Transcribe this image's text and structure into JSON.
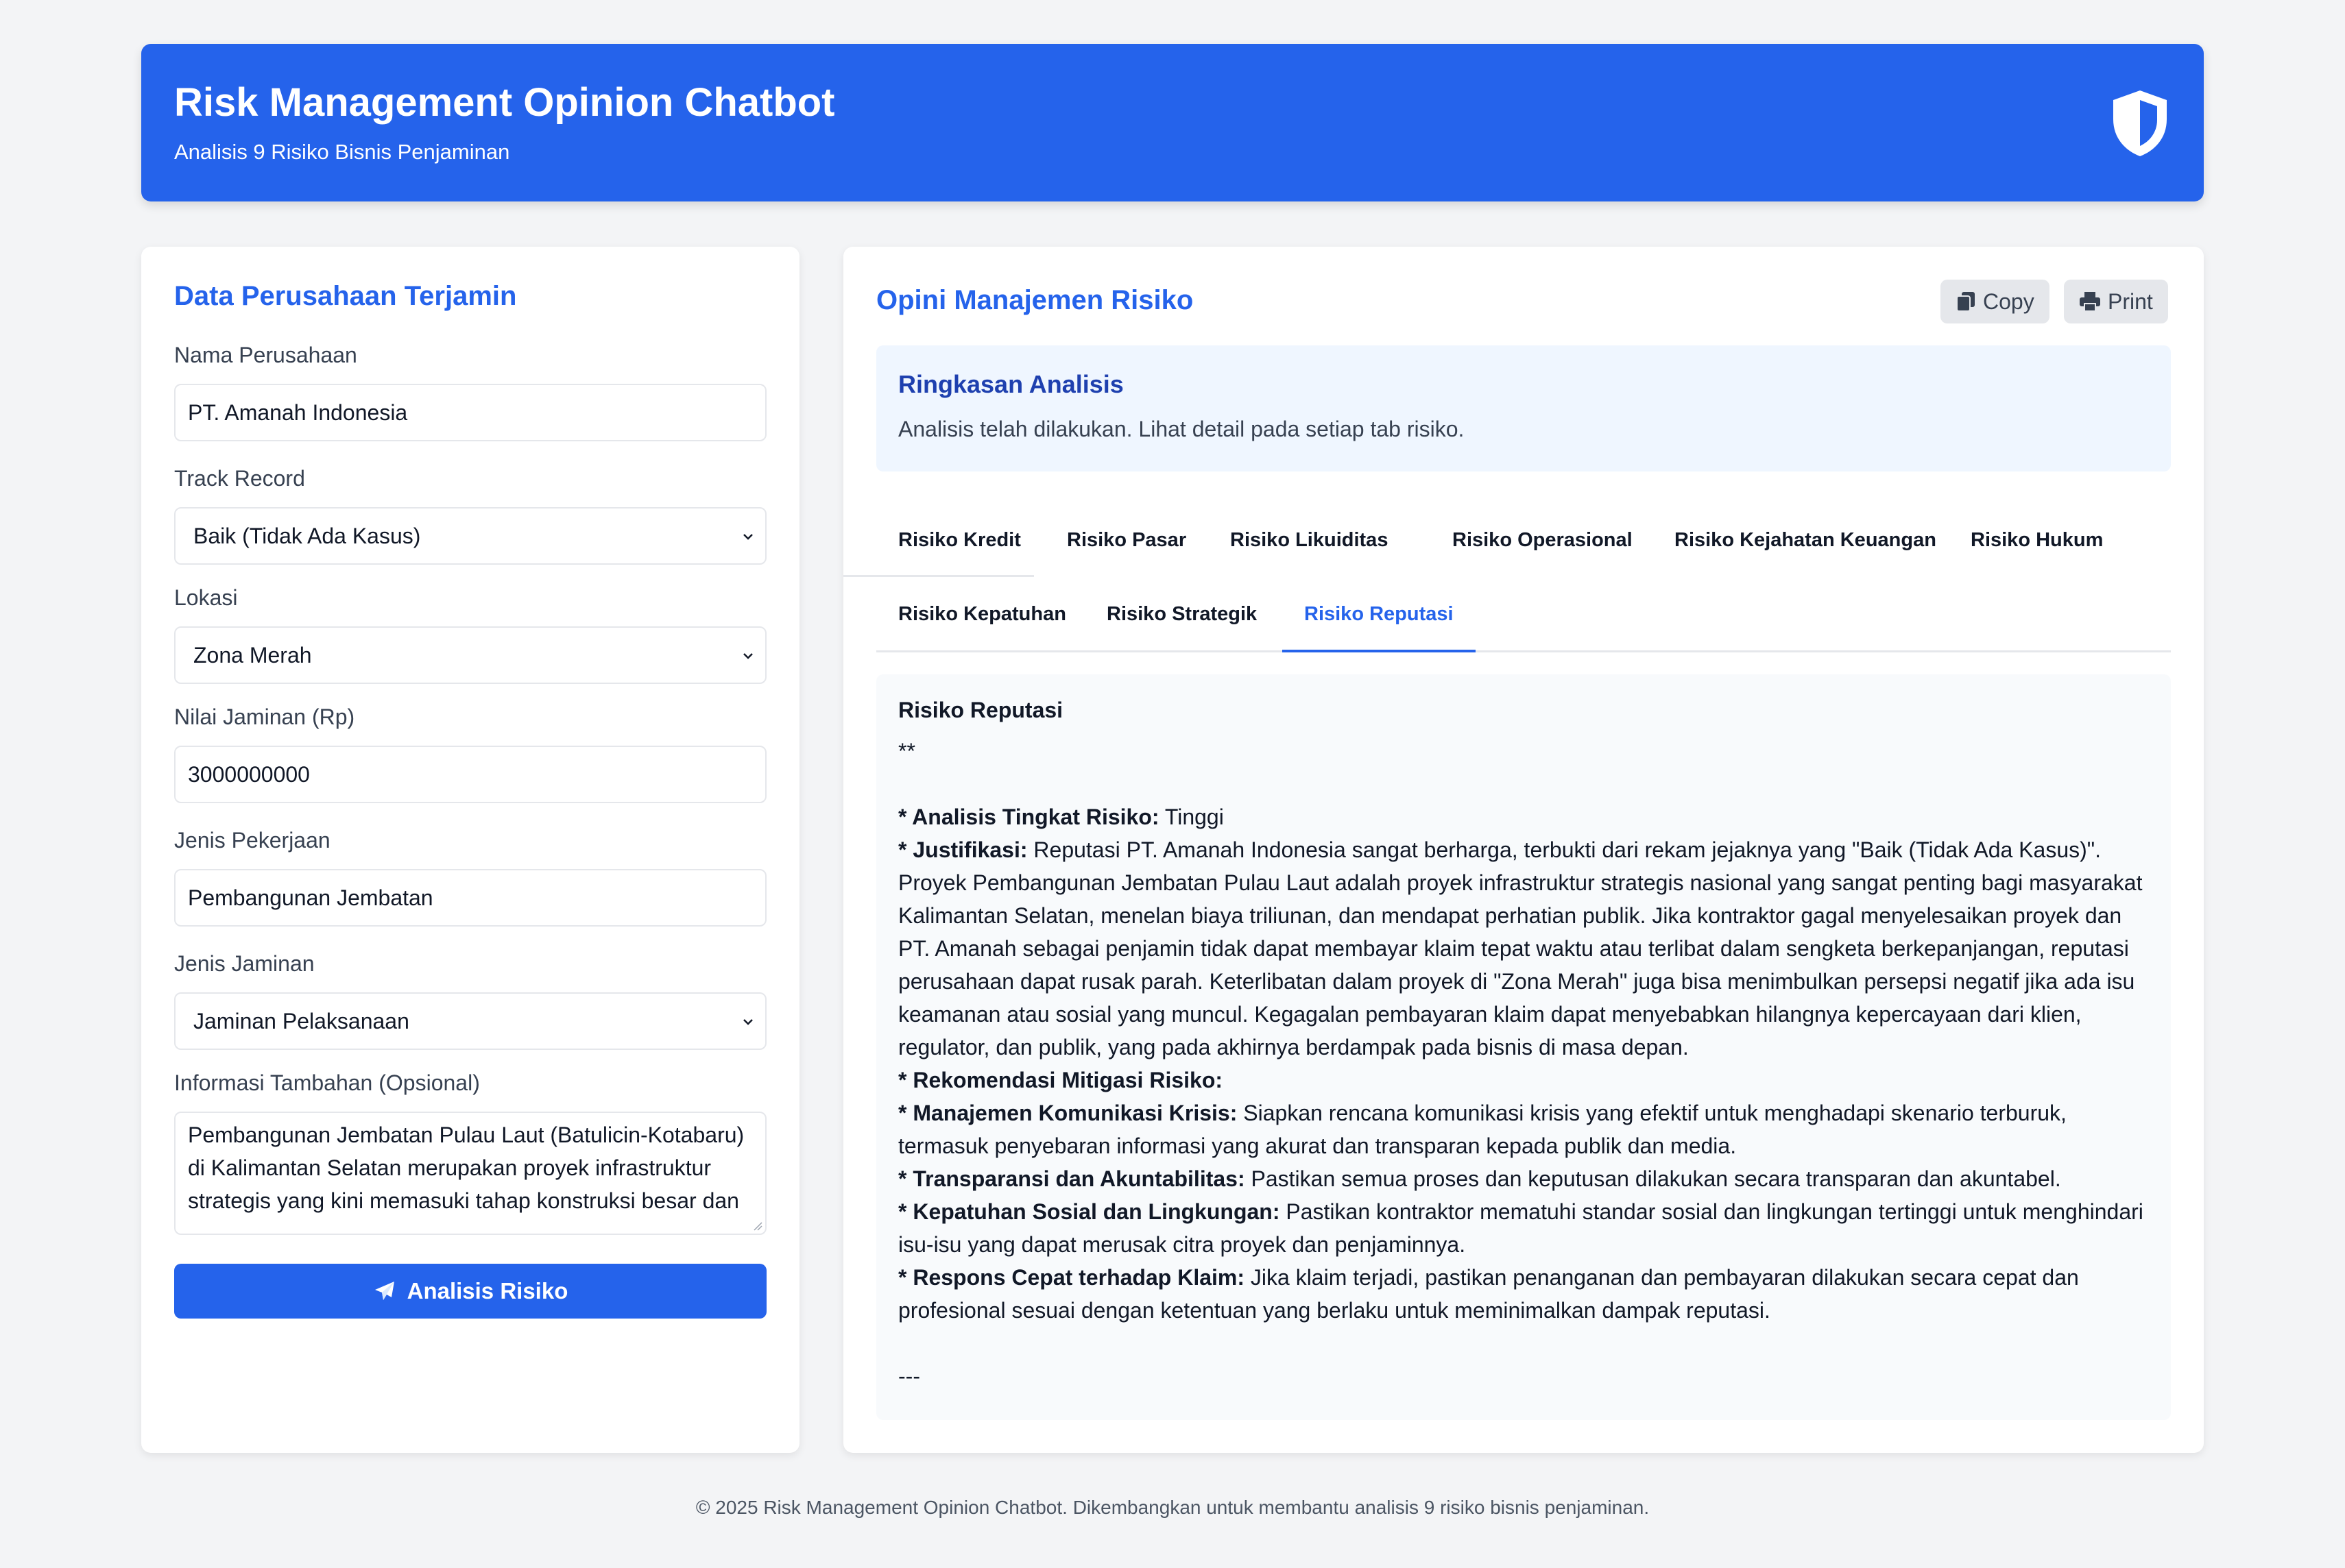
{
  "header": {
    "title": "Risk Management Opinion Chatbot",
    "subtitle": "Analisis 9 Risiko Bisnis Penjaminan",
    "icon": "shield-icon"
  },
  "form": {
    "title": "Data Perusahaan Terjamin",
    "company_name": {
      "label": "Nama Perusahaan",
      "value": "PT. Amanah Indonesia"
    },
    "track_record": {
      "label": "Track Record",
      "value": "Baik (Tidak Ada Kasus)"
    },
    "location": {
      "label": "Lokasi",
      "value": "Zona Merah"
    },
    "guarantee_value": {
      "label": "Nilai Jaminan (Rp)",
      "value": "3000000000"
    },
    "job_type": {
      "label": "Jenis Pekerjaan",
      "value": "Pembangunan Jembatan"
    },
    "guarantee_type": {
      "label": "Jenis Jaminan",
      "value": "Jaminan Pelaksanaan"
    },
    "additional_info": {
      "label": "Informasi Tambahan (Opsional)",
      "value": "Pembangunan Jembatan Pulau Laut (Batulicin-Kotabaru) di Kalimantan Selatan merupakan proyek infrastruktur strategis yang kini memasuki tahap konstruksi besar dan"
    },
    "submit_label": "Analisis Risiko"
  },
  "opinion": {
    "title": "Opini Manajemen Risiko",
    "copy_label": "Copy",
    "print_label": "Print",
    "summary_title": "Ringkasan Analisis",
    "summary_text": "Analisis telah dilakukan. Lihat detail pada setiap tab risiko.",
    "tabs": [
      "Risiko Kredit",
      "Risiko Pasar",
      "Risiko Likuiditas",
      "Risiko Operasional",
      "Risiko Kejahatan Keuangan",
      "Risiko Hukum",
      "Risiko Kepatuhan",
      "Risiko Strategik",
      "Risiko Reputasi"
    ],
    "active_tab": "Risiko Reputasi",
    "content": {
      "heading": "Risiko Reputasi",
      "stars": "**",
      "level_label": "* Analisis Tingkat Risiko:",
      "level_value": " Tinggi",
      "justification_label": "* Justifikasi:",
      "justification_text": " Reputasi PT. Amanah Indonesia sangat berharga, terbukti dari rekam jejaknya yang \"Baik (Tidak Ada Kasus)\". Proyek Pembangunan Jembatan Pulau Laut adalah proyek infrastruktur strategis nasional yang sangat penting bagi masyarakat Kalimantan Selatan, menelan biaya triliunan, dan mendapat perhatian publik. Jika kontraktor gagal menyelesaikan proyek dan PT. Amanah sebagai penjamin tidak dapat membayar klaim tepat waktu atau terlibat dalam sengketa berkepanjangan, reputasi perusahaan dapat rusak parah. Keterlibatan dalam proyek di \"Zona Merah\" juga bisa menimbulkan persepsi negatif jika ada isu keamanan atau sosial yang muncul. Kegagalan pembayaran klaim dapat menyebabkan hilangnya kepercayaan dari klien, regulator, dan publik, yang pada akhirnya berdampak pada bisnis di masa depan.",
      "mitigation_label": "* Rekomendasi Mitigasi Risiko:",
      "m1_label": "* Manajemen Komunikasi Krisis:",
      "m1_text": " Siapkan rencana komunikasi krisis yang efektif untuk menghadapi skenario terburuk, termasuk penyebaran informasi yang akurat dan transparan kepada publik dan media.",
      "m2_label": "* Transparansi dan Akuntabilitas:",
      "m2_text": " Pastikan semua proses dan keputusan dilakukan secara transparan dan akuntabel.",
      "m3_label": "* Kepatuhan Sosial dan Lingkungan:",
      "m3_text": " Pastikan kontraktor mematuhi standar sosial dan lingkungan tertinggi untuk menghindari isu-isu yang dapat merusak citra proyek dan penjaminnya.",
      "m4_label": "* Respons Cepat terhadap Klaim:",
      "m4_text": " Jika klaim terjadi, pastikan penanganan dan pembayaran dilakukan secara cepat dan profesional sesuai dengan ketentuan yang berlaku untuk meminimalkan dampak reputasi.",
      "closing": "---"
    }
  },
  "footer": {
    "text": "© 2025 Risk Management Opinion Chatbot. Dikembangkan untuk membantu analisis 9 risiko bisnis penjaminan."
  },
  "colors": {
    "primary": "#2563eb",
    "background": "#f3f4f6",
    "summary_bg": "#eff6ff"
  }
}
